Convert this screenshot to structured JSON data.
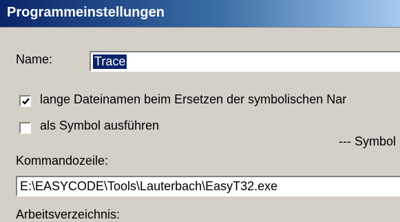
{
  "dialog": {
    "title": "Programmeinstellungen"
  },
  "form": {
    "name_label": "Name:",
    "name_value": "Trace",
    "long_filenames_label": "lange Dateinamen beim Ersetzen der symbolischen Nar",
    "long_filenames_checked": true,
    "run_as_symbol_label": "als Symbol ausführen",
    "run_as_symbol_checked": false,
    "symbol_group_label": "--- Symbol",
    "command_line_label": "Kommandozeile:",
    "command_line_value": "E:\\EASYCODE\\Tools\\Lauterbach\\EasyT32.exe",
    "working_dir_label": "Arbeitsverzeichnis:"
  }
}
